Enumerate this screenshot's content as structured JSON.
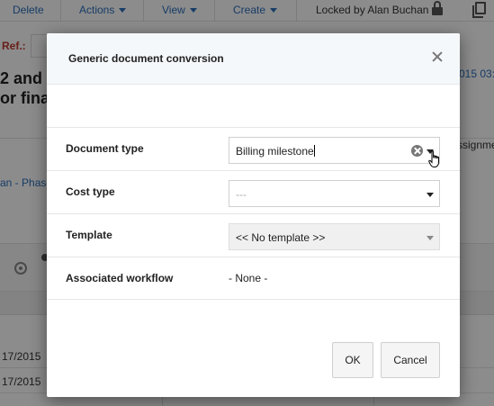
{
  "toolbar": {
    "delete_label": "Delete",
    "actions_label": "Actions",
    "view_label": "View",
    "create_label": "Create",
    "locked_text": "Locked by Alan Buchan"
  },
  "background": {
    "ref_label": "Ref.:",
    "title_fragment": "2 and\nor fina",
    "date_fragment": "015 03:3",
    "assign_fragment": "ssignme",
    "phase_fragment": "an - Phase 1",
    "rows": [
      "17/2015",
      "17/2015",
      ""
    ]
  },
  "dialog": {
    "title": "Generic document conversion",
    "fields": {
      "document_type": {
        "label": "Document type",
        "value": "Billing milestone"
      },
      "cost_type": {
        "label": "Cost type",
        "value": "---"
      },
      "template": {
        "label": "Template",
        "value": "<< No template >>"
      },
      "associated_workflow": {
        "label": "Associated workflow",
        "value": "- None -"
      }
    },
    "ok_label": "OK",
    "cancel_label": "Cancel"
  },
  "colors": {
    "link_blue": "#2a6ebb",
    "ref_red": "#c0392b",
    "overlay": "rgba(0,0,0,0.45)"
  }
}
